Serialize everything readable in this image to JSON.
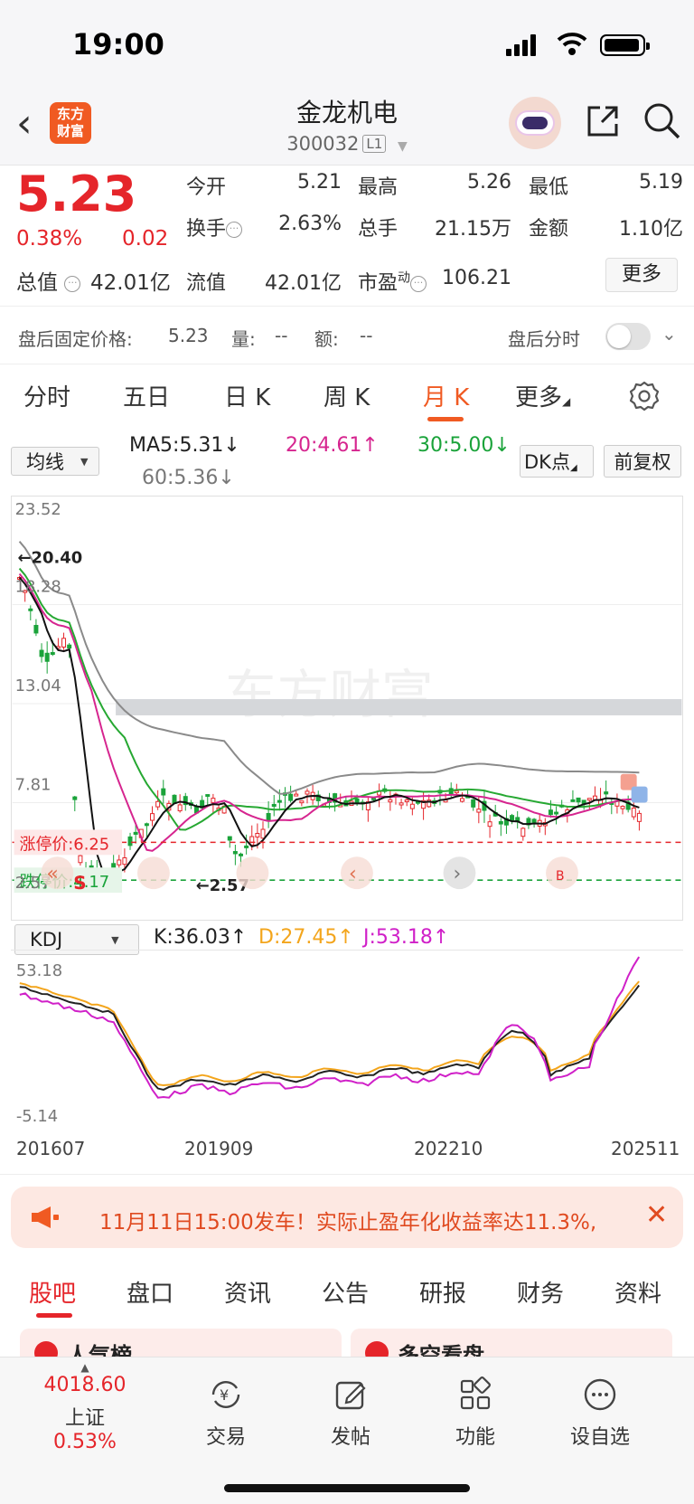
{
  "status_bar": {
    "time": "19:00"
  },
  "header": {
    "back_icon": "chevron-left-icon",
    "logo_text_line1": "东方",
    "logo_text_line2": "财富",
    "stock_name": "金龙机电",
    "stock_code": "300032",
    "level_badge": "L1"
  },
  "quote": {
    "price": "5.23",
    "change_pct": "0.38%",
    "change": "0.02",
    "total_value_label": "总值",
    "total_value": "42.01亿",
    "open_label": "今开",
    "open": "5.21",
    "high_label": "最高",
    "high": "5.26",
    "low_label": "最低",
    "low": "5.19",
    "turnover_label": "换手",
    "turnover": "2.63%",
    "volume_label": "总手",
    "volume": "21.15万",
    "amount_label": "金额",
    "amount": "1.10亿",
    "float_label": "流值",
    "float_value": "42.01亿",
    "pe_label": "市盈",
    "pe_sup": "动",
    "pe": "106.21",
    "more_label": "更多",
    "colors": {
      "up": "#e5252a",
      "down": "#1aa33a"
    }
  },
  "after_hours": {
    "label": "盘后固定价格:",
    "price": "5.23",
    "vol_label": "量:",
    "vol": "--",
    "amt_label": "额:",
    "amt": "--",
    "timeshare_label": "盘后分时"
  },
  "period_tabs": [
    "分时",
    "五日",
    "日 K",
    "周 K",
    "月 K",
    "更多"
  ],
  "indicators": {
    "ma_select": "均线",
    "ma5": "MA5:5.31↓",
    "ma20": "20:4.61↑",
    "ma30": "30:5.00↓",
    "ma60": "60:5.36↓",
    "dk_label": "DK点",
    "adjust_label": "前复权"
  },
  "chart_data": {
    "type": "candlestick",
    "y_labels": [
      "23.52",
      "18.28",
      "13.04",
      "7.81",
      "2.57"
    ],
    "max_marker": "←20.40",
    "min_marker": "2.57",
    "limit_up_label": "涨停价:",
    "limit_up": "6.25",
    "limit_down_label": "跌停价:",
    "limit_down": "4.17",
    "signal_label": "S",
    "signal_label_2": "B",
    "watermark": "东方财富",
    "x_labels": [
      "201607",
      "201909",
      "202210",
      "202511"
    ]
  },
  "kdj": {
    "select": "KDJ",
    "k": "K:36.03↑",
    "d": "D:27.45↑",
    "j": "J:53.18↑",
    "y_max": "53.18",
    "y_min": "-5.14"
  },
  "banner": {
    "icon": "megaphone-icon",
    "text": "11月11日15:00发车！实际止盈年化收益率达11.3%,",
    "close": "✕"
  },
  "bottom_tabs": [
    "股吧",
    "盘口",
    "资讯",
    "公告",
    "研报",
    "财务",
    "资料"
  ],
  "peek": {
    "left": "人气榜",
    "right": "多空看盘"
  },
  "tabbar": {
    "index_value": "4018.60",
    "index_name": "上证",
    "index_change": "0.53%",
    "items": [
      "交易",
      "发帖",
      "功能",
      "设自选"
    ]
  }
}
